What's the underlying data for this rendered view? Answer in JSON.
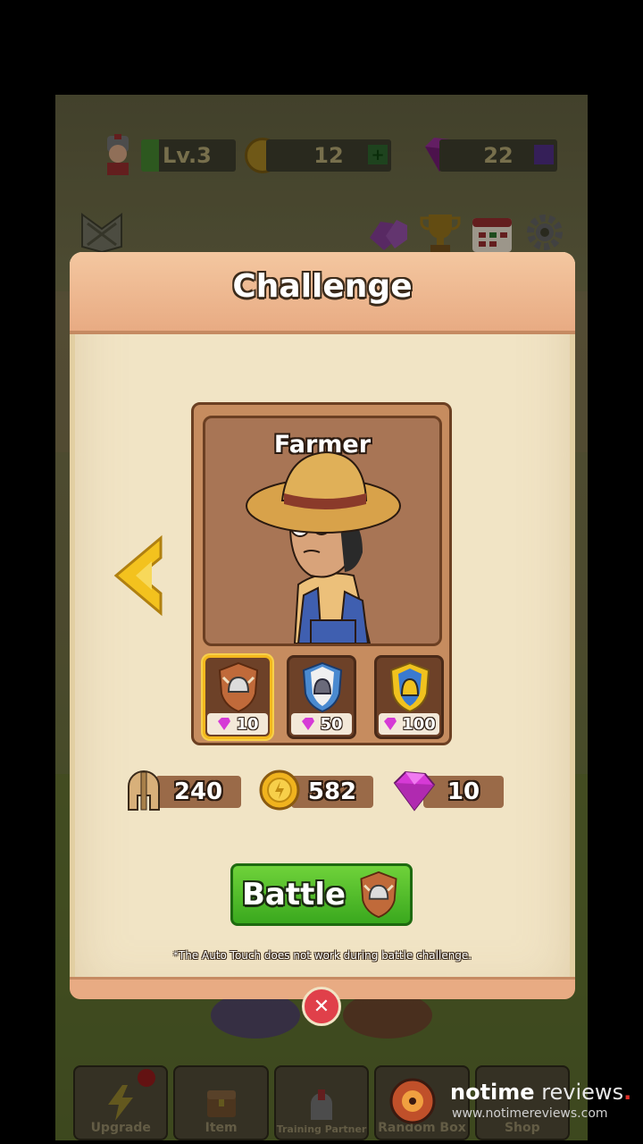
{
  "hud": {
    "level": "Lv.3",
    "gold": "12",
    "gems": "22",
    "plus": "+"
  },
  "dialog": {
    "title": "Challenge",
    "enemy_name": "Farmer",
    "tiers": [
      {
        "cost": "10",
        "selected": true
      },
      {
        "cost": "50",
        "selected": false
      },
      {
        "cost": "100",
        "selected": false
      }
    ],
    "rewards": {
      "helmet": "240",
      "gold": "582",
      "gems": "10"
    },
    "battle_label": "Battle",
    "note": "*The Auto Touch does not work during battle challenge.",
    "close_label": "✕"
  },
  "bottom_nav": {
    "items": [
      {
        "label": "Upgrade"
      },
      {
        "label": "Item"
      },
      {
        "label": "Training Partner"
      },
      {
        "label": "Random Box"
      },
      {
        "label": "Shop"
      }
    ]
  },
  "watermark": {
    "brand_bold": "notime",
    "brand_light": " reviews",
    "url": "www.notimereviews.com"
  },
  "colors": {
    "panel": "#f1e4c5",
    "header": "#e8ab83",
    "battle_green": "#3aa81e",
    "gem_pink": "#d63ad6",
    "gold": "#f0b31e",
    "close_red": "#e0404a"
  }
}
